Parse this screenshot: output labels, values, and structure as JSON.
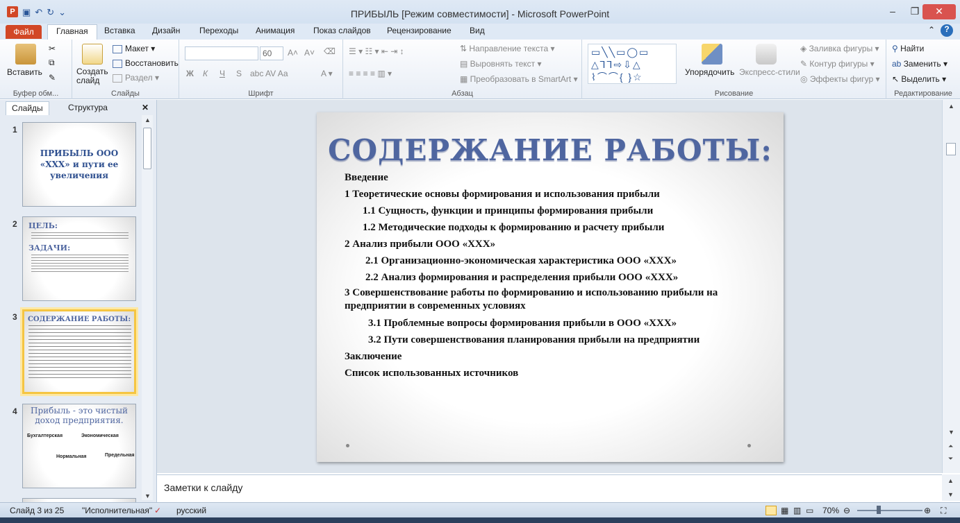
{
  "window": {
    "title": "ПРИБЫЛЬ [Режим совместимости]  -  Microsoft PowerPoint",
    "app_icon": "P",
    "qat": [
      "save-icon",
      "undo-icon",
      "redo-icon",
      "customize-icon"
    ],
    "controls": {
      "minimize": "–",
      "restore": "❐",
      "close": "✕"
    }
  },
  "tabs": {
    "file": "Файл",
    "items": [
      "Главная",
      "Вставка",
      "Дизайн",
      "Переходы",
      "Анимация",
      "Показ слайдов",
      "Рецензирование",
      "Вид"
    ],
    "active": "Главная"
  },
  "ribbon": {
    "clipboard": {
      "paste": "Вставить",
      "label": "Буфер обм..."
    },
    "slides": {
      "new_slide": "Создать слайд",
      "layout": "Макет",
      "reset": "Восстановить",
      "section": "Раздел",
      "label": "Слайды"
    },
    "font": {
      "size": "60",
      "bold": "Ж",
      "italic": "К",
      "underline": "Ч",
      "strike": "S",
      "label": "Шрифт",
      "grow": "A˄",
      "shrink": "A˅"
    },
    "paragraph": {
      "text_direction": "Направление текста",
      "align_text": "Выровнять текст",
      "smartart": "Преобразовать в SmartArt",
      "label": "Абзац"
    },
    "drawing": {
      "arrange": "Упорядочить",
      "quick_styles": "Экспресс-стили",
      "fill": "Заливка фигуры",
      "outline": "Контур фигуры",
      "effects": "Эффекты фигур",
      "label": "Рисование"
    },
    "editing": {
      "find": "Найти",
      "replace": "Заменить",
      "select": "Выделить",
      "label": "Редактирование"
    }
  },
  "left_pane": {
    "tabs": [
      "Слайды",
      "Структура"
    ],
    "close": "✕",
    "thumbnails": [
      {
        "num": "1",
        "title": "ПРИБЫЛЬ ООО «ХХХ» и пути ее увеличения"
      },
      {
        "num": "2",
        "title": "ЦЕЛЬ:",
        "subtitle": "ЗАДАЧИ:"
      },
      {
        "num": "3",
        "title": "СОДЕРЖАНИЕ РАБОТЫ:"
      },
      {
        "num": "4",
        "title": "Прибыль - это чистый доход предприятия.",
        "labels": [
          "Бухгалтерская",
          "Экономическая",
          "Нормальная",
          "Предельная"
        ]
      }
    ]
  },
  "slide": {
    "title": "СОДЕРЖАНИЕ РАБОТЫ:",
    "toc": [
      {
        "level": 1,
        "text": "Введение"
      },
      {
        "level": 1,
        "text": "1 Теоретические основы формирования и использования прибыли"
      },
      {
        "level": 2,
        "text": "1.1 Сущность, функции и принципы формирования прибыли"
      },
      {
        "level": 2,
        "text": "1.2 Методические подходы к формированию и расчету прибыли"
      },
      {
        "level": 1,
        "text": "2 Анализ прибыли ООО «ХХХ»"
      },
      {
        "level": 3,
        "text": "2.1 Организационно-экономическая характеристика  ООО «ХХХ»"
      },
      {
        "level": 3,
        "text": "2.2 Анализ  формирования и распределения прибыли ООО «ХХХ»"
      },
      {
        "level": 1,
        "text": "3 Совершенствование работы по формированию и использованию прибыли на предприятии в современных условиях"
      },
      {
        "level": 4,
        "text": "3.1 Проблемные вопросы формирования прибыли в ООО «ХХХ»"
      },
      {
        "level": 4,
        "text": "3.2 Пути совершенствования планирования прибыли на предприятии"
      },
      {
        "level": 1,
        "text": "Заключение"
      },
      {
        "level": 1,
        "text": "Список использованных источников"
      }
    ]
  },
  "notes": {
    "placeholder": "Заметки к слайду"
  },
  "status": {
    "slide": "Слайд 3 из 25",
    "theme": "\"Исполнительная\"",
    "language": "русский",
    "zoom": "70%"
  }
}
